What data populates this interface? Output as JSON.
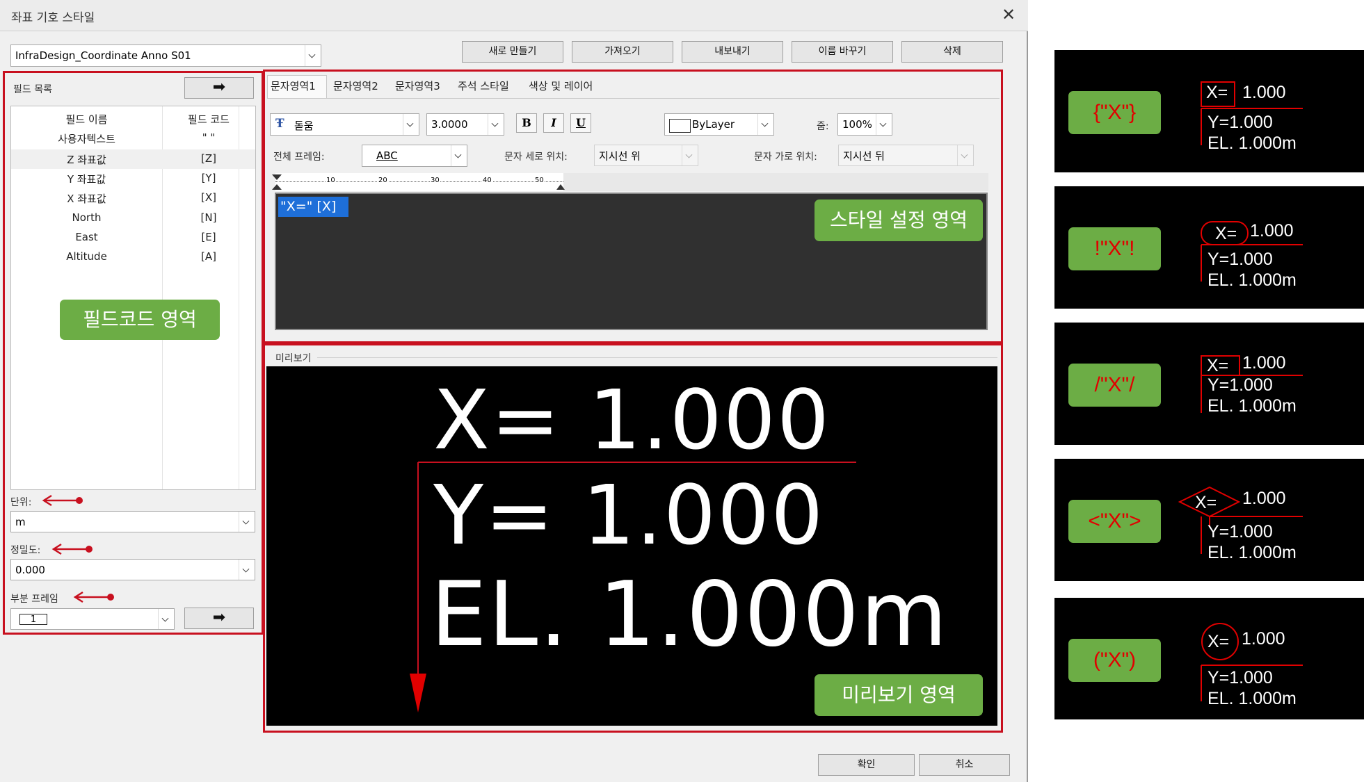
{
  "dialog": {
    "title": "좌표 기호 스타일",
    "close_glyph": "✕",
    "style_name": "InfraDesign_Coordinate Anno S01",
    "buttons": {
      "new": "새로 만들기",
      "import": "가져오기",
      "export": "내보내기",
      "rename": "이름 바꾸기",
      "delete": "삭제"
    },
    "ok": "확인",
    "cancel": "취소"
  },
  "field_panel": {
    "header": "필드 목록",
    "arrow_glyph": "➡",
    "columns": [
      "필드 이름",
      "필드 코드"
    ],
    "rows": [
      {
        "name": "사용자텍스트",
        "code": "\" \""
      },
      {
        "name": "Z 좌표값",
        "code": "[Z]"
      },
      {
        "name": "Y 좌표값",
        "code": "[Y]"
      },
      {
        "name": "X 좌표값",
        "code": "[X]"
      },
      {
        "name": "North",
        "code": "[N]"
      },
      {
        "name": "East",
        "code": "[E]"
      },
      {
        "name": "Altitude",
        "code": "[A]"
      }
    ],
    "unit_label": "단위:",
    "unit_value": "m",
    "precision_label": "정밀도:",
    "precision_value": "0.000",
    "subframe_label": "부분 프레임",
    "subframe_value": "1"
  },
  "tabs": [
    "문자영역1",
    "문자영역2",
    "문자영역3",
    "주석 스타일",
    "색상 및 레이어"
  ],
  "format": {
    "font": "돋움",
    "height": "3.0000",
    "bold": "B",
    "italic": "I",
    "underline": "U",
    "color": "ByLayer",
    "zoom_label": "줌:",
    "zoom": "100%",
    "frame_label": "전체 프레임:",
    "frame_value": "ABC",
    "vpos_label": "문자 세로 위치:",
    "vpos_value": "지시선 위",
    "hpos_label": "문자 가로 위치:",
    "hpos_value": "지시선 뒤"
  },
  "ruler_ticks": [
    "10",
    "20",
    "30",
    "40",
    "50"
  ],
  "editor_text": "\"X=\" [X]",
  "annotations": {
    "field_area": "필드코드 영역",
    "style_area": "스타일 설정 영역",
    "preview_area": "미리보기 영역"
  },
  "preview": {
    "label": "미리보기",
    "line1": "X= 1.000",
    "line2": "Y= 1.000",
    "line3": "EL. 1.000m"
  },
  "examples": [
    {
      "code": "{\"X\"}",
      "x_label": "X=",
      "x_value": "1.000",
      "y": "Y=1.000",
      "el": "EL. 1.000m",
      "frame": "rectangle"
    },
    {
      "code": "!\"X\"!",
      "x_label": "X=",
      "x_value": "1.000",
      "y": "Y=1.000",
      "el": "EL. 1.000m",
      "frame": "rounded"
    },
    {
      "code": "/\"X\"/",
      "x_label": "X=",
      "x_value": "1.000",
      "y": "Y=1.000",
      "el": "EL. 1.000m",
      "frame": "rectangle"
    },
    {
      "code": "<\"X\">",
      "x_label": "X=",
      "x_value": "1.000",
      "y": "Y=1.000",
      "el": "EL. 1.000m",
      "frame": "diamond"
    },
    {
      "code": "(\"X\")",
      "x_label": "X=",
      "x_value": "1.000",
      "y": "Y=1.000",
      "el": "EL. 1.000m",
      "frame": "circle"
    }
  ],
  "colors": {
    "highlight": "#c8101f",
    "green": "#6cad45",
    "selection": "#1e6fd9",
    "editor_bg": "#303030"
  }
}
